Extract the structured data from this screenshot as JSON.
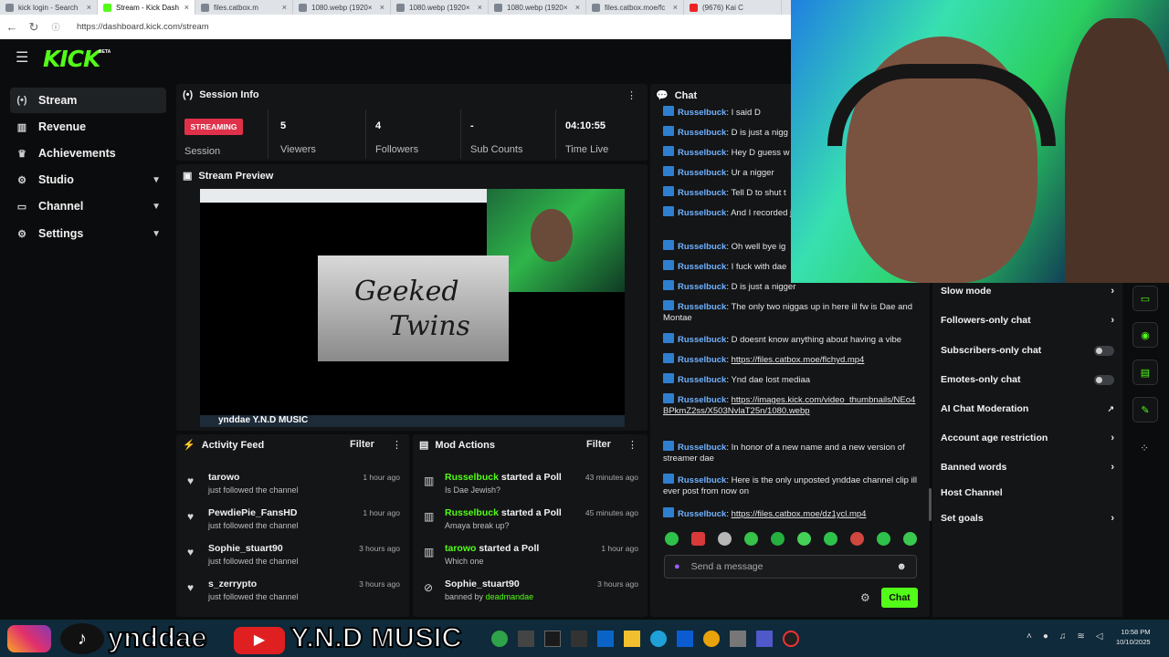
{
  "browser": {
    "tabs": [
      {
        "title": "kick login - Search"
      },
      {
        "title": "Stream - Kick Dash"
      },
      {
        "title": "files.catbox.m"
      },
      {
        "title": "1080.webp (1920×"
      },
      {
        "title": "1080.webp (1920×"
      },
      {
        "title": "1080.webp (1920×"
      },
      {
        "title": "files.catbox.moe/fc"
      },
      {
        "title": "(9676) Kai C"
      }
    ],
    "url": "https://dashboard.kick.com/stream"
  },
  "app": {
    "logo": "KICK",
    "logo_badge": "BETA"
  },
  "sidebar": {
    "items": [
      {
        "label": "Stream",
        "icon": "broadcast-icon"
      },
      {
        "label": "Revenue",
        "icon": "chart-icon"
      },
      {
        "label": "Achievements",
        "icon": "trophy-icon"
      },
      {
        "label": "Studio",
        "icon": "gear-icon"
      },
      {
        "label": "Channel",
        "icon": "tv-icon"
      },
      {
        "label": "Settings",
        "icon": "gear-icon"
      }
    ]
  },
  "session": {
    "title": "Session Info",
    "status": "STREAMING",
    "status_label": "Session",
    "stats": [
      {
        "value": "5",
        "label": "Viewers"
      },
      {
        "value": "4",
        "label": "Followers"
      },
      {
        "value": "-",
        "label": "Sub Counts"
      },
      {
        "value": "04:10:55",
        "label": "Time Live"
      }
    ]
  },
  "preview": {
    "title": "Stream Preview",
    "overlay_text_1": "Geeked",
    "overlay_text_2": "Twins",
    "banner": "ynddae  Y.N.D MUSIC"
  },
  "activity": {
    "title": "Activity Feed",
    "filter": "Filter",
    "items": [
      {
        "name": "tarowo",
        "sub": "just followed the channel",
        "time": "1 hour ago"
      },
      {
        "name": "PewdiePie_FansHD",
        "sub": "just followed the channel",
        "time": "1 hour ago"
      },
      {
        "name": "Sophie_stuart90",
        "sub": "just followed the channel",
        "time": "3 hours ago"
      },
      {
        "name": "s_zerrypto",
        "sub": "just followed the channel",
        "time": "3 hours ago"
      }
    ]
  },
  "mod": {
    "title": "Mod Actions",
    "filter": "Filter",
    "items": [
      {
        "name": "Russelbuck",
        "action": "started a Poll",
        "sub": "Is Dae Jewish?",
        "time": "43 minutes ago"
      },
      {
        "name": "Russelbuck",
        "action": "started a Poll",
        "sub": "Amaya break up?",
        "time": "45 minutes ago"
      },
      {
        "name": "tarowo",
        "action": "started a Poll",
        "sub": "Which one",
        "time": "1 hour ago"
      },
      {
        "name": "Sophie_stuart90",
        "action": "",
        "sub": "banned by",
        "sub_user": "deadmandae",
        "time": "3 hours ago"
      }
    ]
  },
  "chat": {
    "title": "Chat",
    "messages": [
      {
        "user": "Russelbuck",
        "text": "I said D"
      },
      {
        "user": "Russelbuck",
        "text": "D is just a nigg"
      },
      {
        "user": "Russelbuck",
        "text": "Hey D guess w"
      },
      {
        "user": "Russelbuck",
        "text": "Ur a nigger"
      },
      {
        "user": "Russelbuck",
        "text": "Tell D to shut t"
      },
      {
        "user": "Russelbuck",
        "text": "And I recorded jail"
      },
      {
        "user": "Russelbuck",
        "text": "Oh well bye ig"
      },
      {
        "user": "Russelbuck",
        "text": "I fuck with dae"
      },
      {
        "user": "Russelbuck",
        "text": "D is just a nigger"
      },
      {
        "user": "Russelbuck",
        "text": "The only two niggas up in here ill fw is Dae and Montae"
      },
      {
        "user": "Russelbuck",
        "text": "D doesnt know anything about having a vibe"
      },
      {
        "user": "Russelbuck",
        "text": "https://files.catbox.moe/flchyd.mp4",
        "link": true
      },
      {
        "user": "Russelbuck",
        "text": "Ynd dae lost mediaa"
      },
      {
        "user": "Russelbuck",
        "text": "https://images.kick.com/video_thumbnails/NEo4BPkmZ2ss/X503NvlaT25n/1080.webp",
        "link": true
      },
      {
        "user": "Russelbuck",
        "text": "In honor of a new name and a new version of streamer dae"
      },
      {
        "user": "Russelbuck",
        "text": "Here is the only unposted ynddae channel clip ill ever post from now on"
      },
      {
        "user": "Russelbuck",
        "text": "https://files.catbox.moe/dz1ycl.mp4",
        "link": true
      }
    ],
    "placeholder": "Send a message",
    "send": "Chat"
  },
  "settings": {
    "items": [
      {
        "label": "Slow mode",
        "control": "chevron"
      },
      {
        "label": "Followers-only chat",
        "control": "chevron"
      },
      {
        "label": "Subscribers-only chat",
        "control": "toggle"
      },
      {
        "label": "Emotes-only chat",
        "control": "toggle"
      },
      {
        "label": "AI Chat Moderation",
        "control": "external"
      },
      {
        "label": "Account age restriction",
        "control": "chevron"
      },
      {
        "label": "Banned words",
        "control": "chevron"
      },
      {
        "label": "Host Channel",
        "control": "none"
      },
      {
        "label": "Set goals",
        "control": "chevron"
      }
    ]
  },
  "overlay": {
    "social_handle": "ynddae",
    "music": "Y.N.D MUSIC"
  },
  "taskbar": {
    "time": "10:58 PM",
    "date": "10/10/2025"
  },
  "colors": {
    "accent": "#53fc18",
    "streaming": "#e0314a",
    "chat_user": "#6fb1ff"
  }
}
